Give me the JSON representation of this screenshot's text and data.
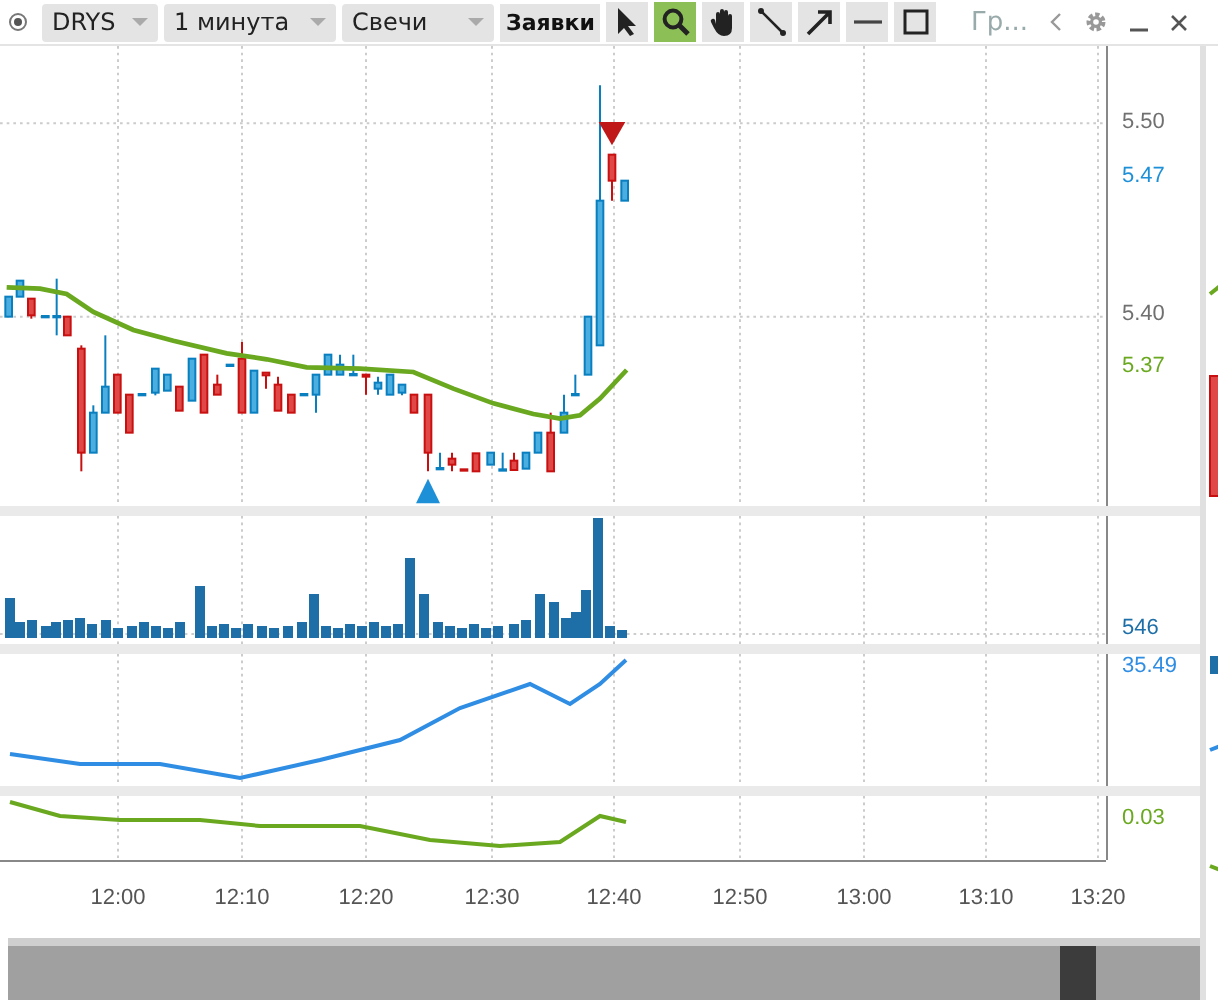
{
  "toolbar": {
    "symbol": "DRYS",
    "interval": "1 минута",
    "chart_type": "Свечи",
    "orders_button": "Заявки",
    "tools": [
      {
        "kind": "cursor",
        "selected": false
      },
      {
        "kind": "zoom",
        "selected": true
      },
      {
        "kind": "hand",
        "selected": false
      },
      {
        "kind": "line",
        "selected": false
      },
      {
        "kind": "arrow",
        "selected": false
      },
      {
        "kind": "hline",
        "selected": false
      },
      {
        "kind": "rect",
        "selected": false
      }
    ],
    "tab_label": "Гр..."
  },
  "price_axis": [
    {
      "text": "5.50",
      "color": "#707070"
    },
    {
      "text": "5.47",
      "color": "#1e90d8"
    },
    {
      "text": "5.40",
      "color": "#707070"
    },
    {
      "text": "5.37",
      "color": "#6aa820"
    }
  ],
  "volume_axis": [
    {
      "text": "546",
      "color": "#1e6fa8"
    }
  ],
  "indicator_axis": [
    {
      "text": "35.49",
      "color": "#2f8de4"
    }
  ],
  "oscillator_axis": [
    {
      "text": "0.03",
      "color": "#6aa820"
    }
  ],
  "time_axis": [
    "12:00",
    "12:10",
    "12:20",
    "12:30",
    "12:40",
    "12:50",
    "13:00",
    "13:10",
    "13:20"
  ]
}
